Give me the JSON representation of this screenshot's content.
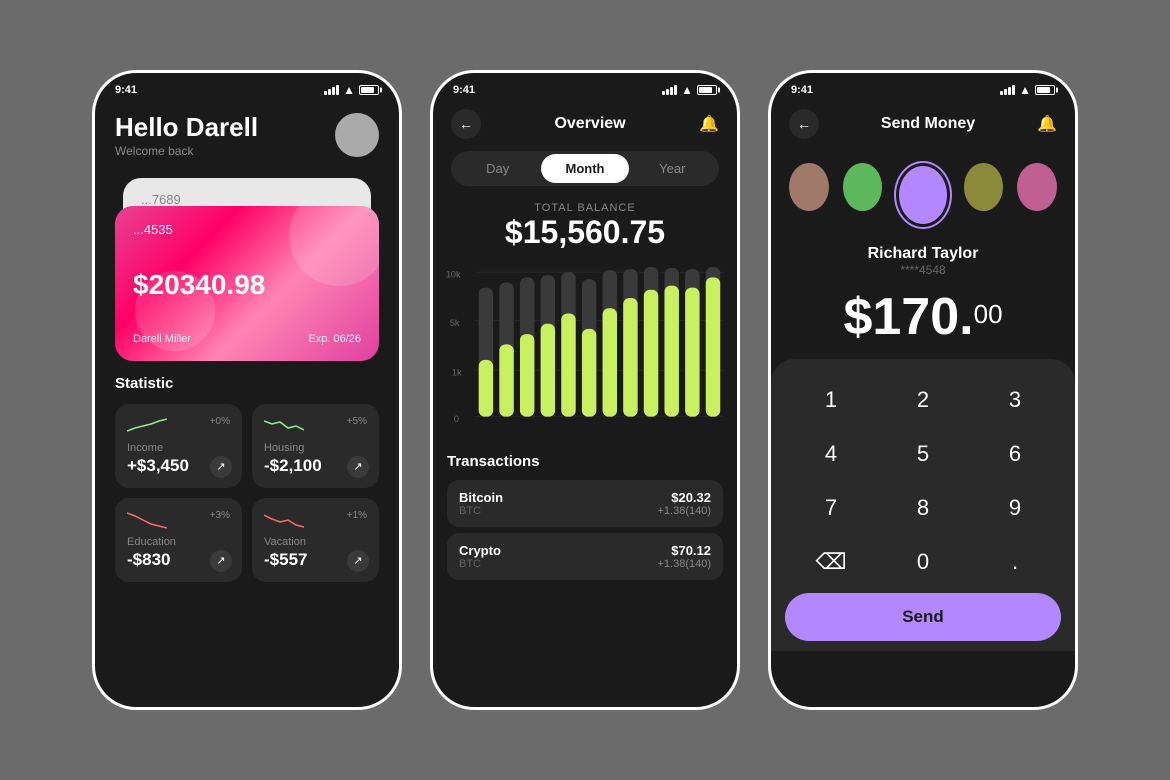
{
  "background": "#6b6b6b",
  "phones": [
    {
      "id": "screen1",
      "statusBar": {
        "time": "9:41",
        "battery": "80"
      },
      "greeting": {
        "hello": "Hello Darell",
        "sub": "Welcome back"
      },
      "cards": [
        {
          "number": "...7689",
          "type": "back"
        },
        {
          "number": "...4535",
          "amount": "$20340.98",
          "name": "Darell Miller",
          "exp": "Exp. 06/26"
        }
      ],
      "statistic": {
        "title": "Statistic",
        "items": [
          {
            "label": "Income",
            "value": "+$3,450",
            "change": "+0%",
            "color": "#90EE90"
          },
          {
            "label": "Housing",
            "value": "-$2,100",
            "change": "+5%",
            "color": "#90EE90"
          },
          {
            "label": "Education",
            "value": "-$830",
            "change": "+3%",
            "color": "#ff6b6b"
          },
          {
            "label": "Vacation",
            "value": "-$557",
            "change": "+1%",
            "color": "#ff6b6b"
          }
        ]
      }
    },
    {
      "id": "screen2",
      "statusBar": {
        "time": "9:41"
      },
      "header": {
        "title": "Overview"
      },
      "periods": [
        "Day",
        "Month",
        "Year"
      ],
      "activePeriod": "Month",
      "balance": {
        "label": "TOTAL BALANCE",
        "amount": "$15,560.75"
      },
      "chart": {
        "yLabels": [
          "10k",
          "5k",
          "1k",
          "0"
        ],
        "bars": [
          30,
          45,
          55,
          65,
          70,
          60,
          75,
          80,
          85,
          90,
          88,
          95
        ]
      },
      "transactions": {
        "title": "Transactions",
        "items": [
          {
            "name": "Bitcoin",
            "sub": "BTC",
            "amount": "$20.32",
            "change": "+1.38(140)"
          },
          {
            "name": "Crypto",
            "sub": "BTC",
            "amount": "$70.12",
            "change": "+1.38(140)"
          }
        ]
      }
    },
    {
      "id": "screen3",
      "statusBar": {
        "time": "9:41"
      },
      "header": {
        "title": "Send Money"
      },
      "contacts": [
        {
          "color": "#a0796a",
          "active": false
        },
        {
          "color": "#5db85d",
          "active": false
        },
        {
          "color": "#b388ff",
          "active": true
        },
        {
          "color": "#8a8a3a",
          "active": false
        },
        {
          "color": "#c06090",
          "active": false
        }
      ],
      "recipient": {
        "name": "Richard Taylor",
        "card": "****4548"
      },
      "amount": {
        "main": "$170.",
        "cents": "00"
      },
      "keypad": [
        "1",
        "2",
        "3",
        "4",
        "5",
        "6",
        "7",
        "8",
        "9",
        "<",
        "0",
        "."
      ],
      "sendLabel": "Send"
    }
  ]
}
